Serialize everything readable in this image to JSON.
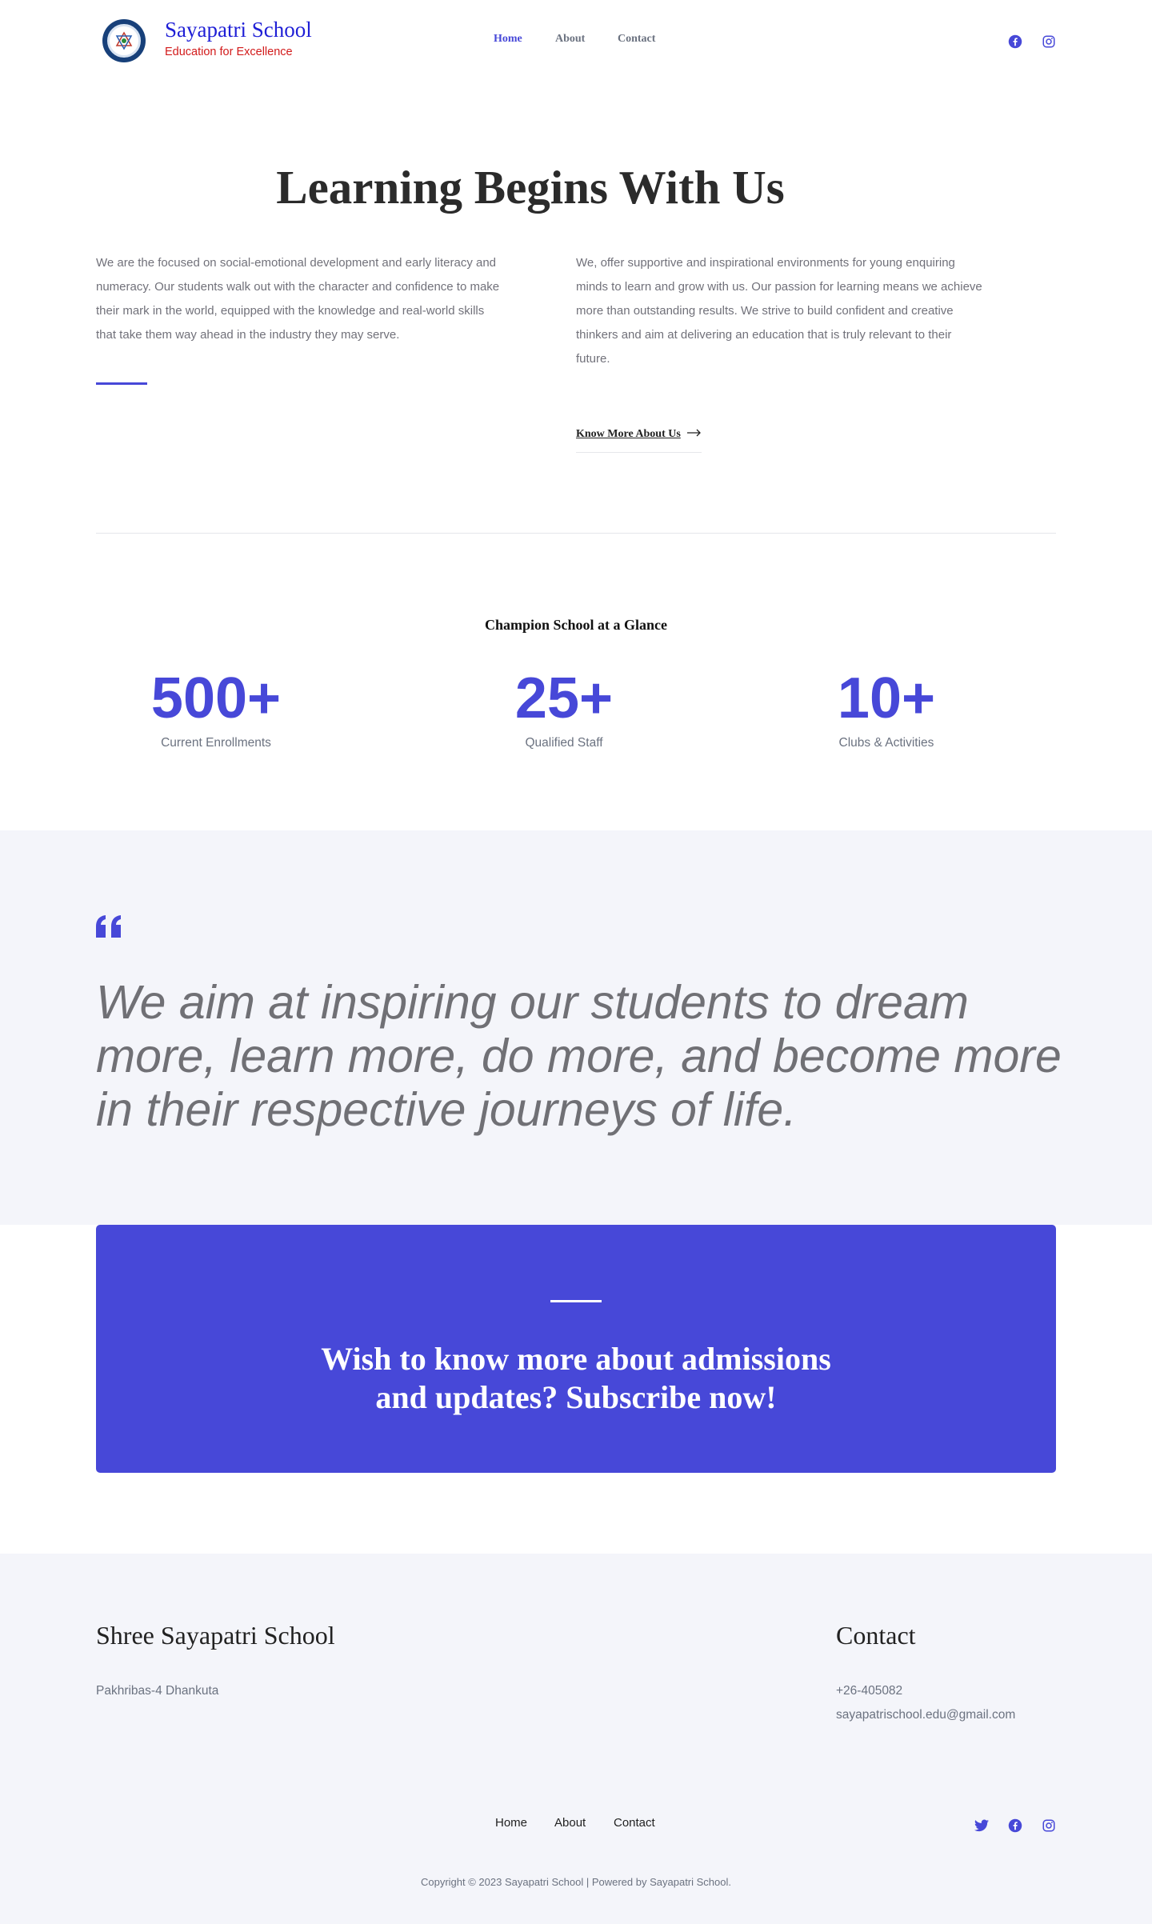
{
  "header": {
    "site_title": "Sayapatri School",
    "tagline": "Education for Excellence",
    "nav": [
      {
        "label": "Home",
        "active": true
      },
      {
        "label": "About",
        "active": false
      },
      {
        "label": "Contact",
        "active": false
      }
    ],
    "social_icons": [
      "facebook-icon",
      "instagram-icon"
    ]
  },
  "intro": {
    "title": "Learning Begins With Us",
    "left_text": "We are the focused on social-emotional development and early literacy and numeracy. Our students walk out with the character and confidence to make their mark in the world, equipped with the knowledge and real-world skills that take them way ahead in the industry they may serve.",
    "right_text": "We,  offer supportive and inspirational environments for young enquiring minds to learn and grow with us. Our passion for learning means we achieve more than outstanding results. We strive to build confident and creative thinkers and aim at delivering an education that is truly relevant to their future.",
    "cta_label": "Know More About Us",
    "cta_icon": "arrow-right-icon"
  },
  "glance": {
    "title": "Champion School at a Glance",
    "stats": [
      {
        "value": "500+",
        "label": "Current Enrollments"
      },
      {
        "value": "25+",
        "label": "Qualified Staff"
      },
      {
        "value": "10+",
        "label": "Clubs & Activities"
      }
    ]
  },
  "quote": {
    "icon": "quote-icon",
    "text": "We aim at inspiring our students to dream more, learn more, do more, and become more in their respective journeys of life."
  },
  "subscribe": {
    "text": "Wish to know more about admissions and updates? Subscribe now!"
  },
  "footer": {
    "school_name": "Shree Sayapatri School",
    "address": "Pakhribas-4 Dhankuta",
    "contact_title": "Contact",
    "phone": "+26-405082",
    "email": "sayapatrischool.edu@gmail.com",
    "nav": [
      "Home",
      "About",
      "Contact"
    ],
    "social_icons": [
      "twitter-icon",
      "facebook-icon",
      "instagram-icon"
    ],
    "copyright": "Copyright © 2023 Sayapatri School | Powered by Sayapatri School."
  },
  "colors": {
    "accent": "#4748d8",
    "title_blue": "#1f1fd6",
    "tagline_red": "#d21a1a",
    "section_bg": "#f4f5fa"
  }
}
